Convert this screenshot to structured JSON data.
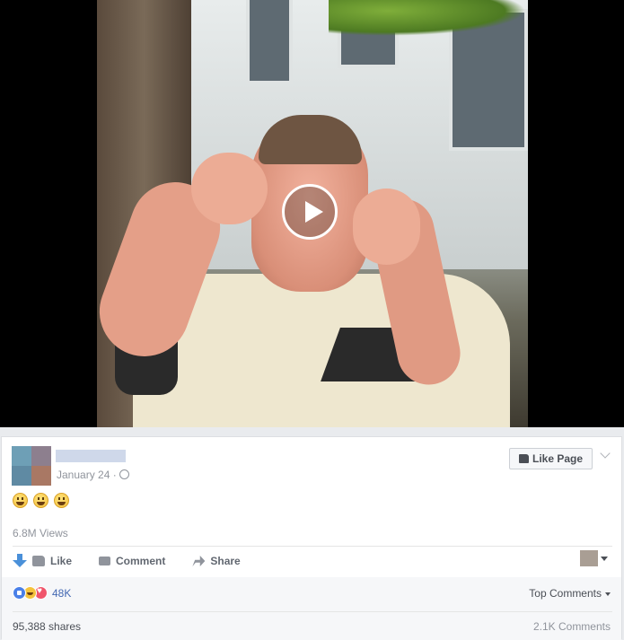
{
  "post": {
    "date": "January 24 ·",
    "like_page_label": "Like Page",
    "emoji_text": [
      "😃",
      "😃",
      "😃"
    ],
    "views": "6.8M Views"
  },
  "actions": {
    "like": "Like",
    "comment": "Comment",
    "share": "Share"
  },
  "footer": {
    "reaction_count": "48K",
    "sort_label": "Top Comments",
    "shares": "95,388 shares",
    "comments": "2.1K Comments"
  }
}
